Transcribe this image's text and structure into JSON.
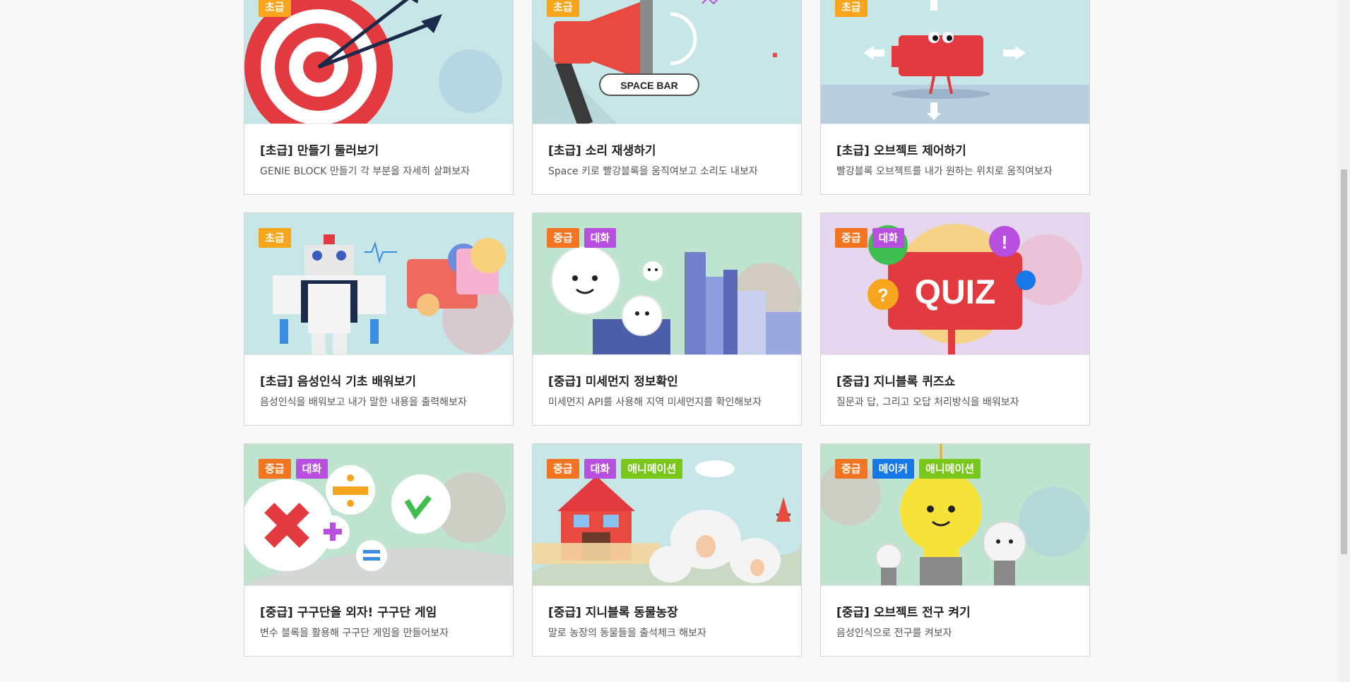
{
  "colors": {
    "basic": "#f7a51d",
    "intermediate": "#f47521",
    "chat": "#b84fe0",
    "animation": "#79c71b",
    "maker": "#1877e6"
  },
  "cards": [
    {
      "tags": [
        {
          "label": "초급",
          "color": "#f7a51d"
        }
      ],
      "title": "[초급] 만들기 둘러보기",
      "desc": "GENIE BLOCK 만들기 각 부분을 자세히 살펴보자",
      "icon": "target-arrows-illustration"
    },
    {
      "tags": [
        {
          "label": "초급",
          "color": "#f7a51d"
        }
      ],
      "title": "[초급] 소리 재생하기",
      "desc": "Space 키로 빨강블록을 움직여보고 소리도 내보자",
      "icon": "megaphone-illustration",
      "illustration_text": "SPACE BAR"
    },
    {
      "tags": [
        {
          "label": "초급",
          "color": "#f7a51d"
        }
      ],
      "title": "[초급] 오브젝트 제어하기",
      "desc": "빨강블록 오브젝트를 내가 원하는 위치로 움직여보자",
      "icon": "red-block-character-illustration"
    },
    {
      "tags": [
        {
          "label": "초급",
          "color": "#f7a51d"
        }
      ],
      "title": "[초급] 음성인식 기초 배워보기",
      "desc": "음성인식을 배워보고 내가 말한 내용을 출력해보자",
      "icon": "robot-speech-illustration"
    },
    {
      "tags": [
        {
          "label": "중급",
          "color": "#f47521"
        },
        {
          "label": "대화",
          "color": "#b84fe0"
        }
      ],
      "title": "[중급] 미세먼지 정보확인",
      "desc": "미세먼지 API를 사용해 지역 미세먼지를 확인해보자",
      "icon": "dust-city-illustration"
    },
    {
      "tags": [
        {
          "label": "중급",
          "color": "#f47521"
        },
        {
          "label": "대화",
          "color": "#b84fe0"
        }
      ],
      "title": "[중급] 지니블록 퀴즈쇼",
      "desc": "질문과 답, 그리고 오답 처리방식을 배워보자",
      "icon": "quiz-sign-illustration",
      "illustration_text": "QUIZ"
    },
    {
      "tags": [
        {
          "label": "중급",
          "color": "#f47521"
        },
        {
          "label": "대화",
          "color": "#b84fe0"
        }
      ],
      "title": "[중급] 구구단을 외자! 구구단 게임",
      "desc": "변수 블록을 활용해 구구단 게임을 만들어보자",
      "icon": "math-symbols-illustration"
    },
    {
      "tags": [
        {
          "label": "중급",
          "color": "#f47521"
        },
        {
          "label": "대화",
          "color": "#b84fe0"
        },
        {
          "label": "애니메이션",
          "color": "#79c71b"
        }
      ],
      "title": "[중급] 지니블록 동물농장",
      "desc": "말로 농장의 동물들을 출석체크 해보자",
      "icon": "farm-sheep-illustration"
    },
    {
      "tags": [
        {
          "label": "중급",
          "color": "#f47521"
        },
        {
          "label": "메이커",
          "color": "#1877e6"
        },
        {
          "label": "애니메이션",
          "color": "#79c71b"
        }
      ],
      "title": "[중급] 오브젝트 전구 켜기",
      "desc": "음성인식으로 전구를 켜보자",
      "icon": "light-bulb-illustration"
    }
  ]
}
